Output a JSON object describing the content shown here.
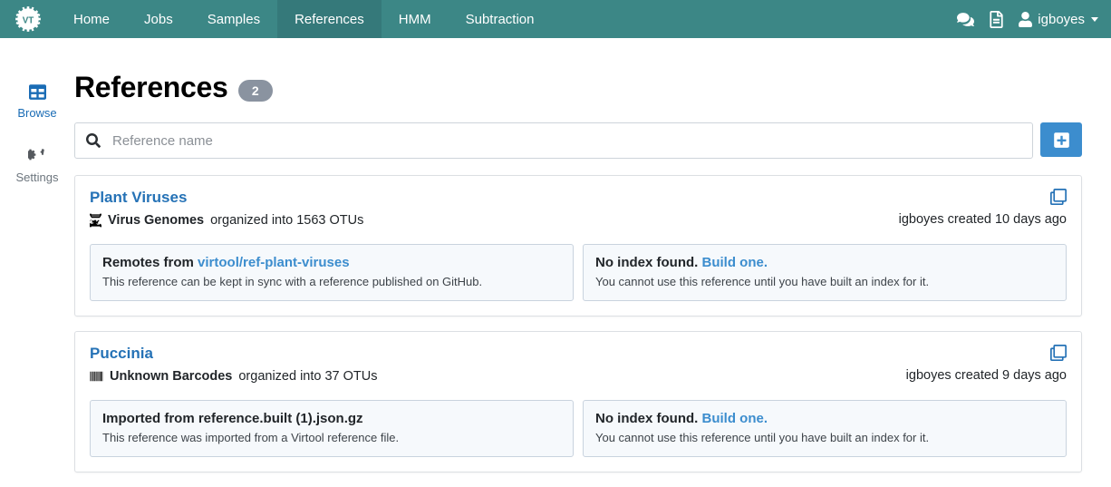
{
  "navbar": {
    "brand_text": "VT",
    "brand_icon": "virtool-cog-logo",
    "items": [
      {
        "label": "Home",
        "active": false
      },
      {
        "label": "Jobs",
        "active": false
      },
      {
        "label": "Samples",
        "active": false
      },
      {
        "label": "References",
        "active": true
      },
      {
        "label": "HMM",
        "active": false
      },
      {
        "label": "Subtraction",
        "active": false
      }
    ],
    "icons": [
      {
        "name": "comments-icon"
      },
      {
        "name": "file-text-icon"
      }
    ],
    "user": "igboyes",
    "colors": {
      "bar": "#3c8786",
      "active_tab": "#35797a"
    }
  },
  "sidebar": {
    "items": [
      {
        "label": "Browse",
        "icon": "table-icon",
        "active": true
      },
      {
        "label": "Settings",
        "icon": "cogs-icon",
        "active": false
      }
    ]
  },
  "header": {
    "title": "References",
    "count_badge": "2"
  },
  "search": {
    "icon": "search-icon",
    "placeholder": "Reference name",
    "value": "",
    "add_button_icon": "plus-square-icon"
  },
  "references": [
    {
      "name": "Plant Viruses",
      "data_type_icon": "dna-icon",
      "data_type": "Virus Genomes",
      "organized_text": "organized into 1563 OTUs",
      "clone_icon": "clone-icon",
      "created": "igboyes created 10 days ago",
      "panels": [
        {
          "title_prefix": "Remotes from ",
          "title_link": "virtool/ref-plant-viruses",
          "title_suffix": "",
          "subtitle": "This reference can be kept in sync with a reference published on GitHub."
        },
        {
          "title_prefix": "No index found. ",
          "title_link": "Build one.",
          "title_suffix": "",
          "subtitle": "You cannot use this reference until you have built an index for it."
        }
      ]
    },
    {
      "name": "Puccinia",
      "data_type_icon": "barcode-icon",
      "data_type": "Unknown Barcodes",
      "organized_text": "organized into 37 OTUs",
      "clone_icon": "clone-icon",
      "created": "igboyes created 9 days ago",
      "panels": [
        {
          "title_prefix": "Imported from reference.built (1).json.gz",
          "title_link": "",
          "title_suffix": "",
          "subtitle": "This reference was imported from a Virtool reference file."
        },
        {
          "title_prefix": "No index found. ",
          "title_link": "Build one.",
          "title_suffix": "",
          "subtitle": "You cannot use this reference until you have built an index for it."
        }
      ]
    }
  ],
  "colors": {
    "accent_blue": "#3c8dce",
    "link_blue": "#2572b6",
    "teal": "#3c8786",
    "badge_gray": "#8a93a0"
  }
}
